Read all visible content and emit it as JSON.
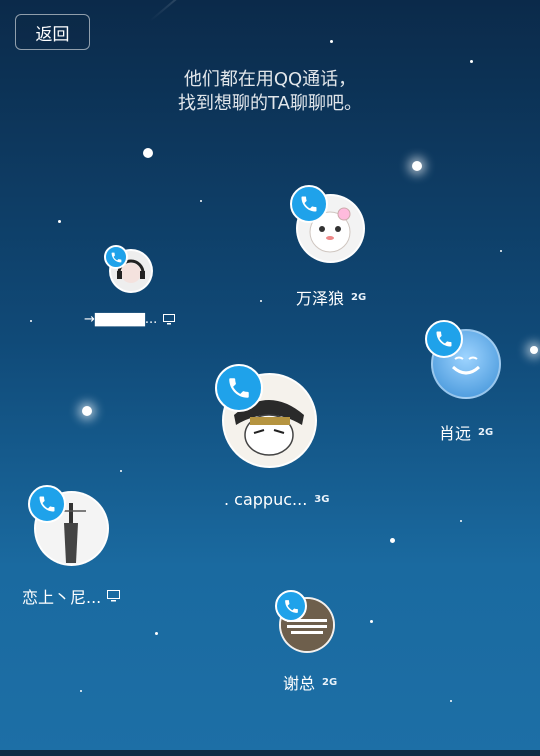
{
  "header": {
    "back_label": "返回",
    "headline_line1": "他们都在用QQ通话，",
    "headline_line2": "找到想聊的TA聊聊吧。"
  },
  "colors": {
    "badge": "#1fa2ea",
    "sky_top": "#0b2a4a",
    "sky_bottom": "#1d6fa6"
  },
  "contacts": [
    {
      "name": "万泽狼",
      "network": "2G",
      "icon": "phone-icon"
    },
    {
      "name": "→▇▇▇▇▇...",
      "network": "",
      "device": "computer-icon",
      "icon": "phone-icon"
    },
    {
      "name": "肖远",
      "network": "2G",
      "icon": "phone-icon"
    },
    {
      "name": ". cappuc...",
      "network": "3G",
      "icon": "phone-icon"
    },
    {
      "name": "恋上丶尼...",
      "network": "",
      "device": "computer-icon",
      "icon": "phone-icon"
    },
    {
      "name": "谢总",
      "network": "2G",
      "icon": "phone-icon"
    }
  ]
}
